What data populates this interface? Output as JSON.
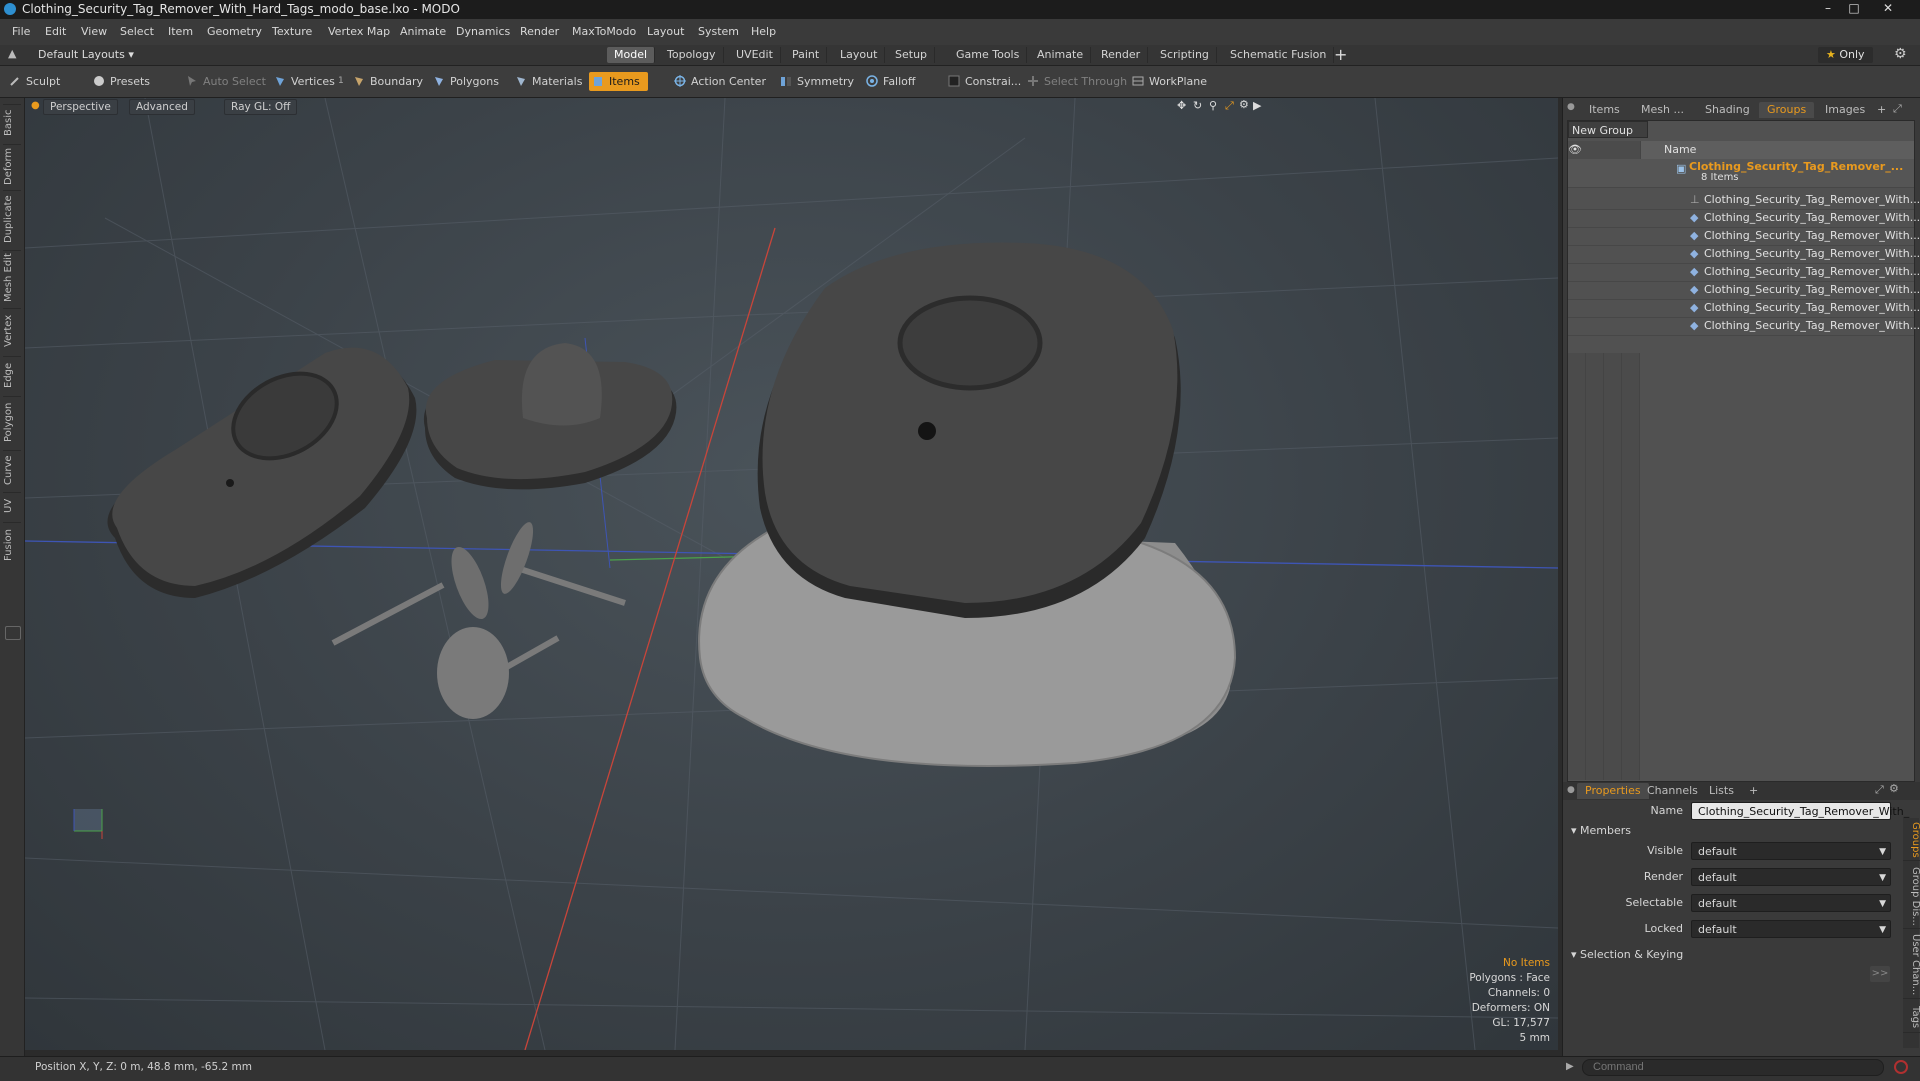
{
  "window": {
    "title": "Clothing_Security_Tag_Remover_With_Hard_Tags_modo_base.lxo - MODO",
    "controls": [
      "minimize-icon",
      "maximize-icon",
      "close-icon"
    ]
  },
  "menu": [
    "File",
    "Edit",
    "View",
    "Select",
    "Item",
    "Geometry",
    "Texture",
    "Vertex Map",
    "Animate",
    "Dynamics",
    "Render",
    "MaxToModo",
    "Layout",
    "System",
    "Help"
  ],
  "layout_bar": {
    "layout_select": "Default Layouts",
    "tabs": [
      "Model",
      "Topology",
      "UVEdit",
      "Paint",
      "Layout",
      "Setup",
      "Game Tools",
      "Animate",
      "Render",
      "Scripting",
      "Schematic Fusion"
    ],
    "active_tab": "Model",
    "add_label": "+",
    "only_label": "Only"
  },
  "toolbar": {
    "sculpt": "Sculpt",
    "presets": "Presets",
    "auto_select": "Auto Select",
    "vertices": "Vertices",
    "vertices_count": "1",
    "boundary": "Boundary",
    "polygons": "Polygons",
    "materials": "Materials",
    "items": "Items",
    "action_center": "Action Center",
    "symmetry": "Symmetry",
    "falloff": "Falloff",
    "constraints": "Constrai...",
    "select_through": "Select Through",
    "workplane": "WorkPlane"
  },
  "left_tabs": [
    "Basic",
    "Deform",
    "Duplicate",
    "Mesh Edit",
    "Vertex",
    "Edge",
    "Polygon",
    "Curve",
    "UV",
    "Fusion"
  ],
  "viewport": {
    "view_mode": "Perspective",
    "shading": "Advanced",
    "raygl": "Ray GL: Off",
    "stats": {
      "selection": "No Items",
      "polygons": "Polygons : Face",
      "channels": "Channels: 0",
      "deformers": "Deformers: ON",
      "gl": "GL: 17,577",
      "scale": "5 mm"
    },
    "colors": {
      "x_axis": "#c8453a",
      "y_axis": "#4aa34a",
      "z_axis": "#4157b8",
      "tag_body": "#3c3c3c",
      "tag_base": "#9a9a9a"
    }
  },
  "right_panel": {
    "tabs": [
      "Items",
      "Mesh ...",
      "Shading",
      "Groups",
      "Images"
    ],
    "active_tab": "Groups",
    "add_tab": "+",
    "new_group": "New Group",
    "name_header": "Name",
    "group": {
      "name": "Clothing_Security_Tag_Remover_...",
      "count": "8 Items",
      "members": [
        "Clothing_Security_Tag_Remover_With...",
        "Clothing_Security_Tag_Remover_With...",
        "Clothing_Security_Tag_Remover_With...",
        "Clothing_Security_Tag_Remover_With...",
        "Clothing_Security_Tag_Remover_With...",
        "Clothing_Security_Tag_Remover_With...",
        "Clothing_Security_Tag_Remover_With...",
        "Clothing_Security_Tag_Remover_With..."
      ]
    },
    "props_tabs": [
      "Properties",
      "Channels",
      "Lists"
    ],
    "props_active": "Properties",
    "props_add": "+",
    "properties": {
      "name_label": "Name",
      "name_value": "Clothing_Security_Tag_Remover_With_",
      "members_section": "Members",
      "visible_label": "Visible",
      "visible_value": "default",
      "render_label": "Render",
      "render_value": "default",
      "selectable_label": "Selectable",
      "selectable_value": "default",
      "locked_label": "Locked",
      "locked_value": "default",
      "selection_section": "Selection & Keying",
      "more_button": ">>"
    },
    "side_tabs": [
      "Groups",
      "Group Dis...",
      "User Chan...",
      "Tags"
    ]
  },
  "status": {
    "position": "Position X, Y, Z:  0 m, 48.8 mm, -65.2 mm",
    "command_placeholder": "Command"
  }
}
